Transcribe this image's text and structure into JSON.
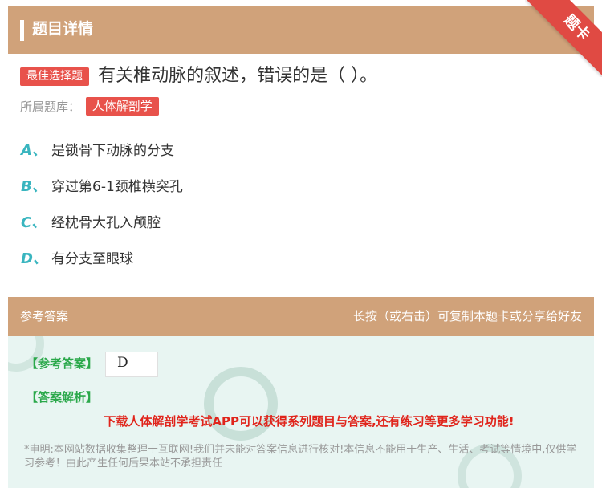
{
  "header": {
    "title": "题目详情",
    "corner_label": "题卡"
  },
  "question": {
    "type_tag": "最佳选择题",
    "text": "有关椎动脉的叙述，错误的是（ ）。",
    "library_label": "所属题库：",
    "library_name": "人体解剖学"
  },
  "options": [
    {
      "letter": "A、",
      "text": "是锁骨下动脉的分支"
    },
    {
      "letter": "B、",
      "text": "穿过第6-1颈椎横突孔"
    },
    {
      "letter": "C、",
      "text": "经枕骨大孔入颅腔"
    },
    {
      "letter": "D、",
      "text": "有分支至眼球"
    }
  ],
  "answer_section": {
    "title": "参考答案",
    "share_hint": "长按（或右击）可复制本题卡或分享给好友",
    "answer_label": "【参考答案】",
    "answer_value": "D",
    "analysis_label": "【答案解析】",
    "promo_text": "下载人体解剖学考试APP可以获得系列题目与答案,还有练习等更多学习功能!",
    "disclaimer": "*申明:本网站数据收集整理于互联网!我们并未能对答案信息进行核对!本信息不能用于生产、生活、考试等情境中,仅供学习参考！由此产生任何后果本站不承担责任"
  },
  "colors": {
    "header_bg": "#d0a27a",
    "tag_red": "#e8524b",
    "option_letter": "#39b5bf",
    "answer_green": "#2aa84a",
    "promo_red": "#e0241b",
    "answer_bg": "#e8f5f2"
  }
}
